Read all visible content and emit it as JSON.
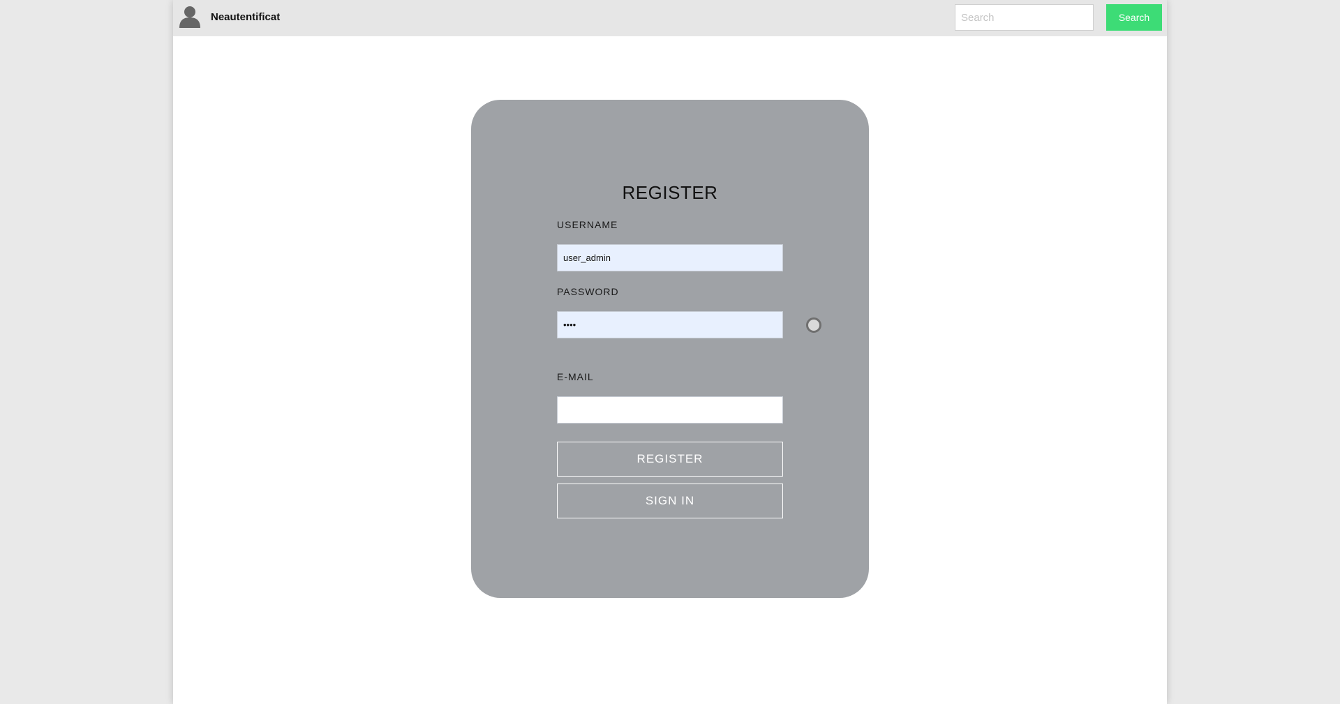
{
  "header": {
    "brand": "Neautentificat",
    "avatar_icon": "user-avatar-icon",
    "search_placeholder": "Search",
    "search_value": "",
    "search_button": "Search"
  },
  "form": {
    "title": "REGISTER",
    "username_label": "USERNAME",
    "username_value": "user_admin",
    "password_label": "PASSWORD",
    "password_value": "••••",
    "show_password_icon": "radio-toggle-icon",
    "email_label": "E-MAIL",
    "email_value": "",
    "register_button": "REGISTER",
    "signin_button": "SIGN IN"
  },
  "colors": {
    "page_background": "#e9e9e9",
    "header_background": "#e6e6e6",
    "card_background": "#9fa2a6",
    "search_button": "#3ddc76",
    "autofill_field": "#e8f0fe"
  }
}
